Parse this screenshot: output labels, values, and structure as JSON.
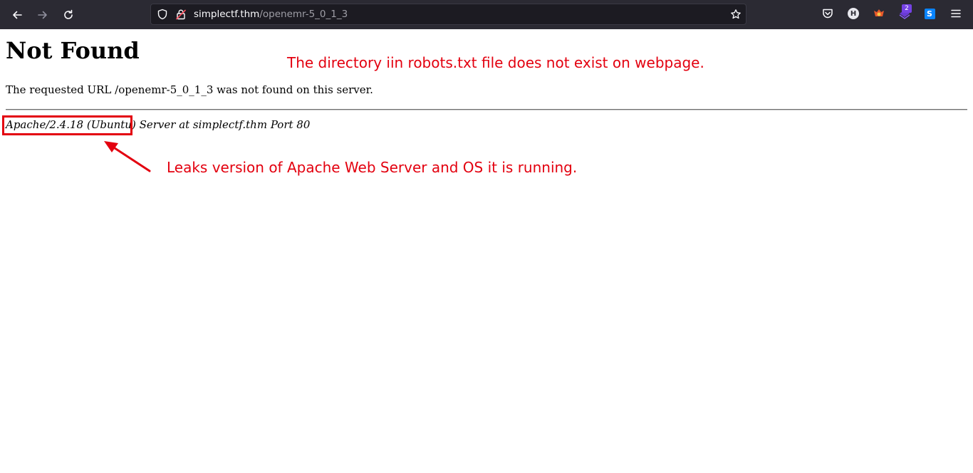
{
  "browser": {
    "url_host": "simplectf.thm",
    "url_path": "/openemr-5_0_1_3",
    "account_initial": "H",
    "extension_badge": "2",
    "extension_s_label": "S"
  },
  "page": {
    "title": "Not Found",
    "message": "The requested URL /openemr-5_0_1_3 was not found on this server.",
    "server_signature_highlight": "Apache/2.4.18 (Ubuntu)",
    "server_signature_rest": " Server at simplectf.thm Port 80"
  },
  "annotations": {
    "robots_note": "The directory iin robots.txt file does not exist on webpage.",
    "leak_note": "Leaks version of Apache Web Server and OS it is running."
  },
  "colors": {
    "toolbar_bg": "#2b2a33",
    "urlbar_bg": "#1c1b22",
    "annotation_red": "#e3000f"
  }
}
